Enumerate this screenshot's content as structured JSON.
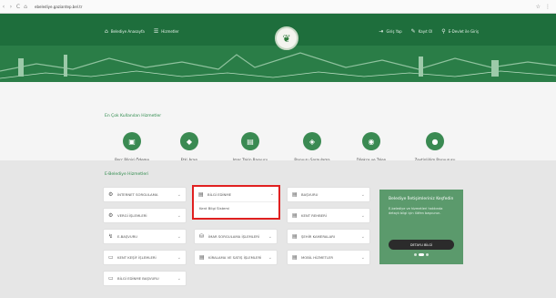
{
  "browser": {
    "url": "ebelediye.gaziantep.bel.tr",
    "nav": {
      "back": "‹",
      "forward": "›",
      "reload": "C",
      "home": "⌂"
    },
    "right_icons": [
      "☆",
      "⋮"
    ]
  },
  "header": {
    "links_left": [
      {
        "icon": "⌂",
        "label": "Belediye Anasayfa"
      },
      {
        "icon": "☰",
        "label": "Hizmetler"
      }
    ],
    "links_right": [
      {
        "icon": "⇥",
        "label": "Giriş Yap"
      },
      {
        "icon": "✎",
        "label": "Kayıt Ol"
      },
      {
        "icon": "⚲",
        "label": "E-Devlet ile Giriş"
      }
    ],
    "logo_glyph": "❦"
  },
  "popular": {
    "title": "En Çok Kullanılan Hizmetler",
    "items": [
      {
        "icon": "▣",
        "label": "Borç Bilgisi Ödeme"
      },
      {
        "icon": "◆",
        "label": "Etki Arası"
      },
      {
        "icon": "▤",
        "label": "Imar Takip Başvuru"
      },
      {
        "icon": "◈",
        "label": "Başvuru Sorgulama"
      },
      {
        "icon": "◉",
        "label": "Dilekçe ve Talep"
      },
      {
        "icon": "●",
        "label": "Zeytinliğim Başvurusu"
      }
    ]
  },
  "services": {
    "title": "E-Belediye Hizmetleri",
    "left_col": [
      {
        "icon": "⚙",
        "label": "İNTERNET SORGULAMA"
      },
      {
        "icon": "⚙",
        "label": "VERGİ İŞLEMLERİ"
      },
      {
        "icon": "↯",
        "label": "E-BAŞVURU"
      },
      {
        "icon": "▭",
        "label": "KENT KEŞİF İŞLEMLERİ"
      },
      {
        "icon": "▭",
        "label": "BİLGİ EDİNME BAŞVURU"
      }
    ],
    "mid_col": [
      {
        "icon": "▤",
        "label": "BİLGİ EDİNME"
      },
      {
        "icon": "⛁",
        "label": "İMAR SORGULAMA İŞLEMLERİ"
      },
      {
        "icon": "▤",
        "label": "KİRALAMA VE SATIŞ İŞLEMLERİ"
      }
    ],
    "mid_sub": "Kent Bilgi Sistemi",
    "right_col": [
      {
        "icon": "▤",
        "label": "BAŞVURU"
      },
      {
        "icon": "▤",
        "label": "KENT REHBERİ"
      },
      {
        "icon": "▤",
        "label": "ŞEHİR KAMERALARI"
      },
      {
        "icon": "▤",
        "label": "MOBİL HİZMETLER"
      }
    ],
    "chevron": "⌄"
  },
  "promo": {
    "title": "Belediye İletişimleriniz Keşfedin",
    "desc": "E-belediye ve hizmetleri hakkında detaylı bilgi için lütfen başvurun.",
    "button": "DETAYLI BİLGİ"
  }
}
